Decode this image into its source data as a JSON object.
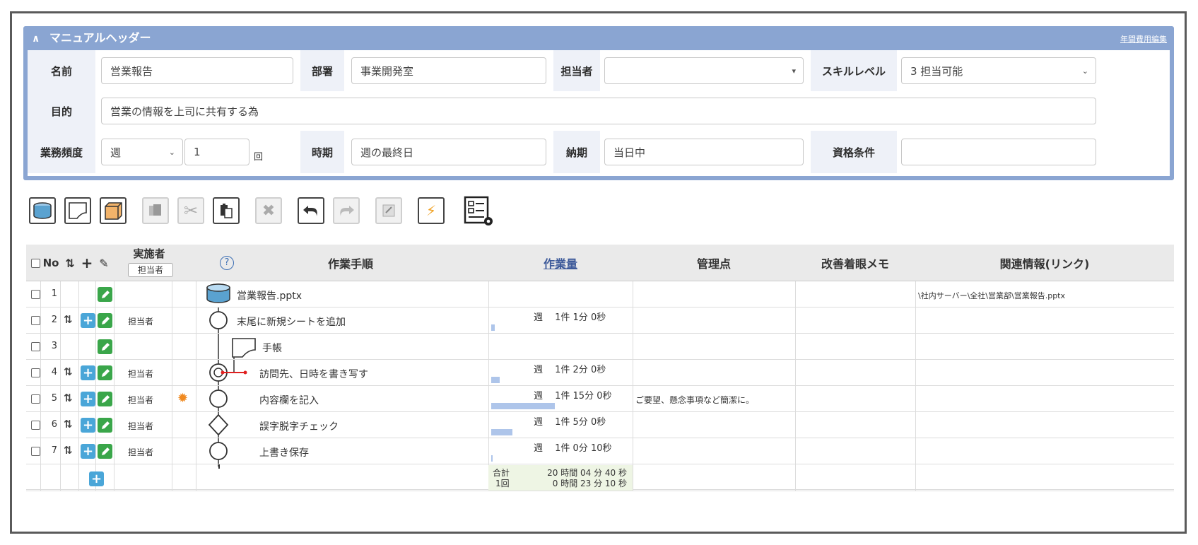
{
  "header": {
    "title": "マニュアルヘッダー",
    "annual_cost_link": "年間費用編集",
    "fields": {
      "name_label": "名前",
      "name_value": "営業報告",
      "dept_label": "部署",
      "dept_value": "事業開発室",
      "owner_label": "担当者",
      "owner_value": "",
      "skill_label": "スキルレベル",
      "skill_value": "3 担当可能",
      "purpose_label": "目的",
      "purpose_value": "営業の情報を上司に共有する為",
      "freq_label": "業務頻度",
      "freq_unit_value": "週",
      "freq_count_value": "1",
      "freq_count_suffix": "回",
      "timing_label": "時期",
      "timing_value": "週の最終日",
      "deadline_label": "納期",
      "deadline_value": "当日中",
      "qual_label": "資格条件",
      "qual_value": ""
    }
  },
  "toolbar": {
    "buttons": [
      "data-icon",
      "document-icon",
      "box-icon",
      "copy-icon",
      "cut-icon",
      "paste-icon",
      "delete-icon",
      "undo-icon",
      "redo-icon",
      "note-icon",
      "flash-icon",
      "checklist-settings-icon"
    ]
  },
  "table": {
    "headers": {
      "no": "No",
      "performer": "実施者",
      "owner_btn": "担当者",
      "help": "?",
      "procedure": "作業手順",
      "volume": "作業量",
      "control": "管理点",
      "memo": "改善着眼メモ",
      "related": "関連情報(リンク)"
    },
    "rows": [
      {
        "no": "1",
        "person": "",
        "step": "営業報告.pptx",
        "volume": "",
        "bar": 0,
        "memo": "",
        "related": "\\社内サーバー\\全社\\営業部\\営業報告.pptx",
        "shape": "data"
      },
      {
        "no": "2",
        "person": "担当者",
        "step": "末尾に新規シートを追加",
        "volume": "週　 1件  1分  0秒",
        "bar": 0.04,
        "memo": "",
        "related": "",
        "shape": "circle"
      },
      {
        "no": "3",
        "person": "",
        "step": "手帳",
        "volume": "",
        "bar": 0,
        "memo": "",
        "related": "",
        "shape": "document"
      },
      {
        "no": "4",
        "person": "担当者",
        "step": "訪問先、日時を書き写す",
        "volume": "週　 1件  2分  0秒",
        "bar": 0.1,
        "memo": "",
        "related": "",
        "shape": "double-circle"
      },
      {
        "no": "5",
        "person": "担当者",
        "step": "内容欄を記入",
        "volume": "週　 1件 15分  0秒",
        "bar": 0.75,
        "memo": "ご要望、懸念事項など簡潔に。",
        "related": "",
        "shape": "circle"
      },
      {
        "no": "6",
        "person": "担当者",
        "step": "誤字脱字チェック",
        "volume": "週　 1件  5分  0秒",
        "bar": 0.25,
        "memo": "",
        "related": "",
        "shape": "diamond"
      },
      {
        "no": "7",
        "person": "担当者",
        "step": "上書き保存",
        "volume": "週　 1件  0分 10秒",
        "bar": 0.01,
        "memo": "",
        "related": "",
        "shape": "circle"
      }
    ],
    "totals": {
      "total_label": "合計",
      "total_value": "20 時間 04 分 40 秒",
      "per_label": "1回",
      "per_value": "0 時間 23 分 10 秒"
    }
  },
  "colors": {
    "header_bar": "#8aa5d2",
    "label_bg": "#eef1f8",
    "plus_button": "#4aa6d8",
    "edit_button": "#3aa64a",
    "volume_bar": "#aec5ea",
    "totals_bg": "#eef5e4"
  }
}
